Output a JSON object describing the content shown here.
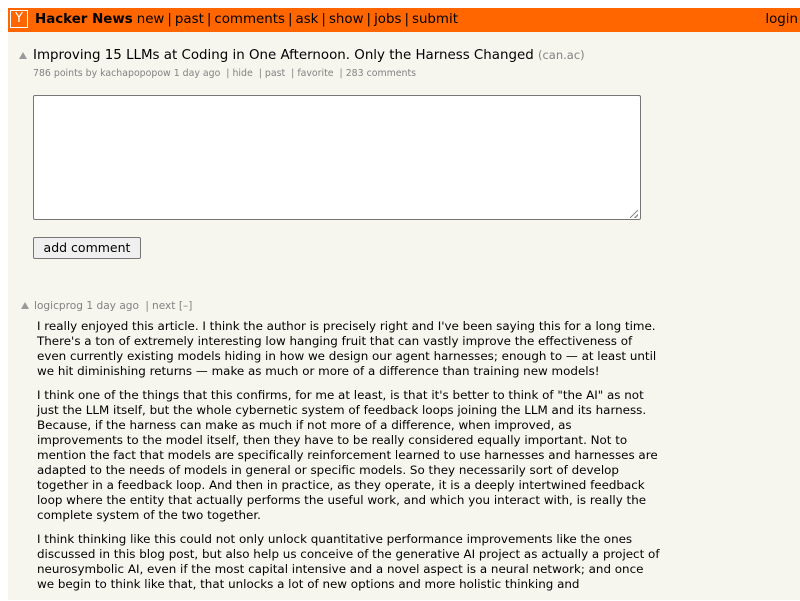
{
  "header": {
    "logo": "Y",
    "site_name": "Hacker News",
    "nav": [
      "new",
      "past",
      "comments",
      "ask",
      "show",
      "jobs",
      "submit"
    ],
    "login": "login",
    "bar_color": "#ff6600"
  },
  "story": {
    "title": "Improving 15 LLMs at Coding in One Afternoon. Only the Harness Changed",
    "domain": "(can.ac)",
    "points": "786 points",
    "by_label": "by",
    "author": "kachapopopow",
    "age": "1 day ago",
    "actions": [
      "hide",
      "past",
      "favorite",
      "283 comments"
    ]
  },
  "form": {
    "textarea_value": "",
    "button_label": "add comment"
  },
  "comment": {
    "author": "logicprog",
    "age": "1 day ago",
    "next": "next",
    "collapse": "[–]",
    "paragraphs": [
      "I really enjoyed this article. I think the author is precisely right and I've been saying this for a long time. There's a ton of extremely interesting low hanging fruit that can vastly improve the effectiveness of even currently existing models hiding in how we design our agent harnesses; enough to — at least until we hit diminishing returns — make as much or more of a difference than training new models!",
      "I think one of the things that this confirms, for me at least, is that it's better to think of \"the AI\" as not just the LLM itself, but the whole cybernetic system of feedback loops joining the LLM and its harness. Because, if the harness can make as much if not more of a difference, when improved, as improvements to the model itself, then they have to be really considered equally important. Not to mention the fact that models are specifically reinforcement learned to use harnesses and harnesses are adapted to the needs of models in general or specific models. So they necessarily sort of develop together in a feedback loop. And then in practice, as they operate, it is a deeply intertwined feedback loop where the entity that actually performs the useful work, and which you interact with, is really the complete system of the two together.",
      "I think thinking like this could not only unlock quantitative performance improvements like the ones discussed in this blog post, but also help us conceive of the generative AI project as actually a project of neurosymbolic AI, even if the most capital intensive and a novel aspect is a neural network; and once we begin to think like that, that unlocks a lot of new options and more holistic thinking and"
    ]
  }
}
